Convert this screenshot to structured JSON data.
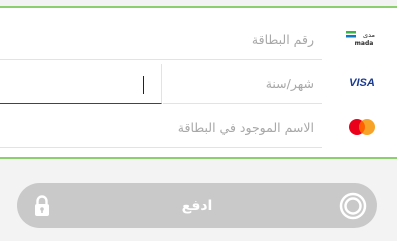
{
  "form": {
    "card_number_placeholder": "رقم البطاقة",
    "expiry_placeholder": "شهر/سنة",
    "cvv_value": "",
    "cardholder_placeholder": "الاسم الموجود في البطاقة"
  },
  "logos": {
    "mada_arabic": "مدى",
    "mada_latin": "mada",
    "visa": "VISA"
  },
  "pay_button": {
    "label": "ادفع"
  },
  "colors": {
    "panel_border": "#8ccf6e",
    "button_bg": "#c9c9c9",
    "visa_blue": "#1a3a8f",
    "mada_green": "#3cb24a",
    "mada_blue": "#0a7bbf",
    "mastercard_red": "#eb001b",
    "mastercard_orange": "#f79e1b"
  }
}
